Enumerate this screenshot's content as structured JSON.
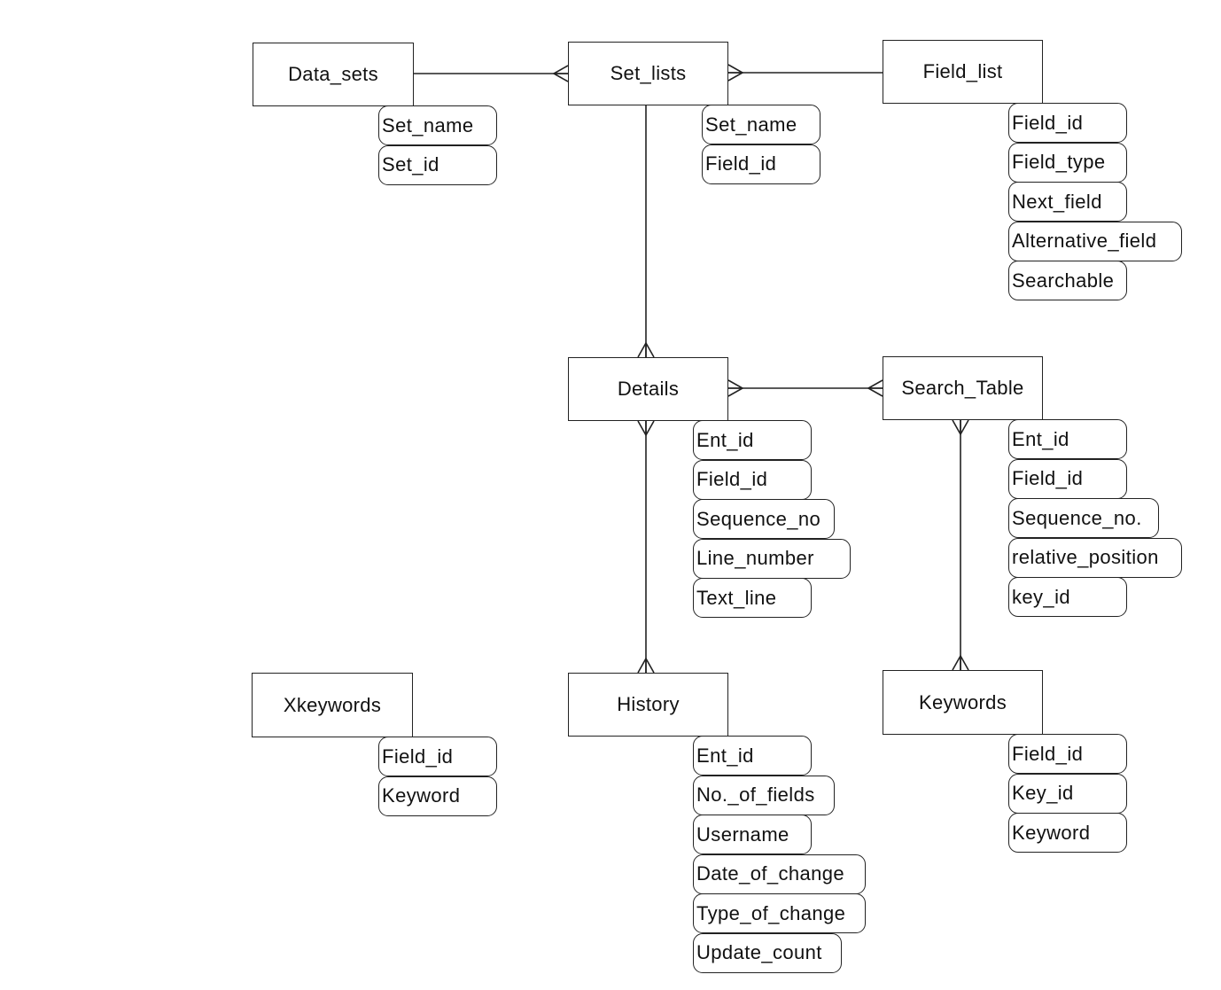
{
  "diagram": {
    "type": "entity-relationship",
    "notation": "crow's foot",
    "entities": [
      {
        "id": "data_sets",
        "name": "Data_sets",
        "attributes": [
          "Set_name",
          "Set_id"
        ]
      },
      {
        "id": "set_lists",
        "name": "Set_lists",
        "attributes": [
          "Set_name",
          "Field_id"
        ]
      },
      {
        "id": "field_list",
        "name": "Field_list",
        "attributes": [
          "Field_id",
          "Field_type",
          "Next_field",
          "Alternative_field",
          "Searchable"
        ]
      },
      {
        "id": "details",
        "name": "Details",
        "attributes": [
          "Ent_id",
          "Field_id",
          "Sequence_no",
          "Line_number",
          "Text_line"
        ]
      },
      {
        "id": "search_table",
        "name": "Search_Table",
        "attributes": [
          "Ent_id",
          "Field_id",
          "Sequence_no.",
          "relative_position",
          "key_id"
        ]
      },
      {
        "id": "xkeywords",
        "name": "Xkeywords",
        "attributes": [
          "Field_id",
          "Keyword"
        ]
      },
      {
        "id": "history",
        "name": "History",
        "attributes": [
          "Ent_id",
          "No._of_fields",
          "Username",
          "Date_of_change",
          "Type_of_change",
          "Update_count"
        ]
      },
      {
        "id": "keywords",
        "name": "Keywords",
        "attributes": [
          "Field_id",
          "Key_id",
          "Keyword"
        ]
      }
    ],
    "relationships": [
      {
        "from": "data_sets",
        "to": "set_lists",
        "from_card": "one",
        "to_card": "many"
      },
      {
        "from": "set_lists",
        "to": "field_list",
        "from_card": "many",
        "to_card": "one"
      },
      {
        "from": "set_lists",
        "to": "details",
        "from_card": "one",
        "to_card": "many"
      },
      {
        "from": "details",
        "to": "search_table",
        "from_card": "many",
        "to_card": "many"
      },
      {
        "from": "details",
        "to": "history",
        "from_card": "many",
        "to_card": "many"
      },
      {
        "from": "search_table",
        "to": "keywords",
        "from_card": "many",
        "to_card": "many"
      }
    ]
  }
}
